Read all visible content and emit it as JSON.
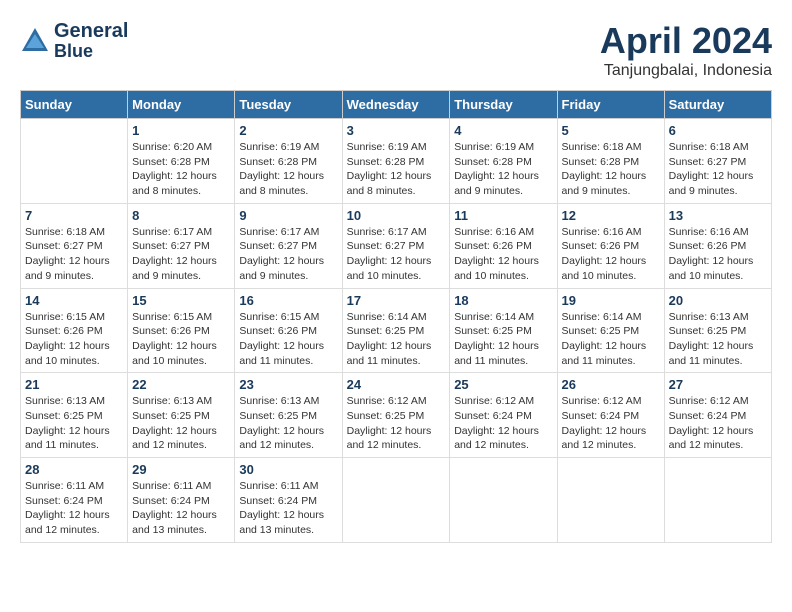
{
  "header": {
    "logo_line1": "General",
    "logo_line2": "Blue",
    "title": "April 2024",
    "subtitle": "Tanjungbalai, Indonesia"
  },
  "calendar": {
    "days_of_week": [
      "Sunday",
      "Monday",
      "Tuesday",
      "Wednesday",
      "Thursday",
      "Friday",
      "Saturday"
    ],
    "weeks": [
      [
        {
          "num": "",
          "info": ""
        },
        {
          "num": "1",
          "info": "Sunrise: 6:20 AM\nSunset: 6:28 PM\nDaylight: 12 hours\nand 8 minutes."
        },
        {
          "num": "2",
          "info": "Sunrise: 6:19 AM\nSunset: 6:28 PM\nDaylight: 12 hours\nand 8 minutes."
        },
        {
          "num": "3",
          "info": "Sunrise: 6:19 AM\nSunset: 6:28 PM\nDaylight: 12 hours\nand 8 minutes."
        },
        {
          "num": "4",
          "info": "Sunrise: 6:19 AM\nSunset: 6:28 PM\nDaylight: 12 hours\nand 9 minutes."
        },
        {
          "num": "5",
          "info": "Sunrise: 6:18 AM\nSunset: 6:28 PM\nDaylight: 12 hours\nand 9 minutes."
        },
        {
          "num": "6",
          "info": "Sunrise: 6:18 AM\nSunset: 6:27 PM\nDaylight: 12 hours\nand 9 minutes."
        }
      ],
      [
        {
          "num": "7",
          "info": "Sunrise: 6:18 AM\nSunset: 6:27 PM\nDaylight: 12 hours\nand 9 minutes."
        },
        {
          "num": "8",
          "info": "Sunrise: 6:17 AM\nSunset: 6:27 PM\nDaylight: 12 hours\nand 9 minutes."
        },
        {
          "num": "9",
          "info": "Sunrise: 6:17 AM\nSunset: 6:27 PM\nDaylight: 12 hours\nand 9 minutes."
        },
        {
          "num": "10",
          "info": "Sunrise: 6:17 AM\nSunset: 6:27 PM\nDaylight: 12 hours\nand 10 minutes."
        },
        {
          "num": "11",
          "info": "Sunrise: 6:16 AM\nSunset: 6:26 PM\nDaylight: 12 hours\nand 10 minutes."
        },
        {
          "num": "12",
          "info": "Sunrise: 6:16 AM\nSunset: 6:26 PM\nDaylight: 12 hours\nand 10 minutes."
        },
        {
          "num": "13",
          "info": "Sunrise: 6:16 AM\nSunset: 6:26 PM\nDaylight: 12 hours\nand 10 minutes."
        }
      ],
      [
        {
          "num": "14",
          "info": "Sunrise: 6:15 AM\nSunset: 6:26 PM\nDaylight: 12 hours\nand 10 minutes."
        },
        {
          "num": "15",
          "info": "Sunrise: 6:15 AM\nSunset: 6:26 PM\nDaylight: 12 hours\nand 10 minutes."
        },
        {
          "num": "16",
          "info": "Sunrise: 6:15 AM\nSunset: 6:26 PM\nDaylight: 12 hours\nand 11 minutes."
        },
        {
          "num": "17",
          "info": "Sunrise: 6:14 AM\nSunset: 6:25 PM\nDaylight: 12 hours\nand 11 minutes."
        },
        {
          "num": "18",
          "info": "Sunrise: 6:14 AM\nSunset: 6:25 PM\nDaylight: 12 hours\nand 11 minutes."
        },
        {
          "num": "19",
          "info": "Sunrise: 6:14 AM\nSunset: 6:25 PM\nDaylight: 12 hours\nand 11 minutes."
        },
        {
          "num": "20",
          "info": "Sunrise: 6:13 AM\nSunset: 6:25 PM\nDaylight: 12 hours\nand 11 minutes."
        }
      ],
      [
        {
          "num": "21",
          "info": "Sunrise: 6:13 AM\nSunset: 6:25 PM\nDaylight: 12 hours\nand 11 minutes."
        },
        {
          "num": "22",
          "info": "Sunrise: 6:13 AM\nSunset: 6:25 PM\nDaylight: 12 hours\nand 12 minutes."
        },
        {
          "num": "23",
          "info": "Sunrise: 6:13 AM\nSunset: 6:25 PM\nDaylight: 12 hours\nand 12 minutes."
        },
        {
          "num": "24",
          "info": "Sunrise: 6:12 AM\nSunset: 6:25 PM\nDaylight: 12 hours\nand 12 minutes."
        },
        {
          "num": "25",
          "info": "Sunrise: 6:12 AM\nSunset: 6:24 PM\nDaylight: 12 hours\nand 12 minutes."
        },
        {
          "num": "26",
          "info": "Sunrise: 6:12 AM\nSunset: 6:24 PM\nDaylight: 12 hours\nand 12 minutes."
        },
        {
          "num": "27",
          "info": "Sunrise: 6:12 AM\nSunset: 6:24 PM\nDaylight: 12 hours\nand 12 minutes."
        }
      ],
      [
        {
          "num": "28",
          "info": "Sunrise: 6:11 AM\nSunset: 6:24 PM\nDaylight: 12 hours\nand 12 minutes."
        },
        {
          "num": "29",
          "info": "Sunrise: 6:11 AM\nSunset: 6:24 PM\nDaylight: 12 hours\nand 13 minutes."
        },
        {
          "num": "30",
          "info": "Sunrise: 6:11 AM\nSunset: 6:24 PM\nDaylight: 12 hours\nand 13 minutes."
        },
        {
          "num": "",
          "info": ""
        },
        {
          "num": "",
          "info": ""
        },
        {
          "num": "",
          "info": ""
        },
        {
          "num": "",
          "info": ""
        }
      ]
    ]
  }
}
